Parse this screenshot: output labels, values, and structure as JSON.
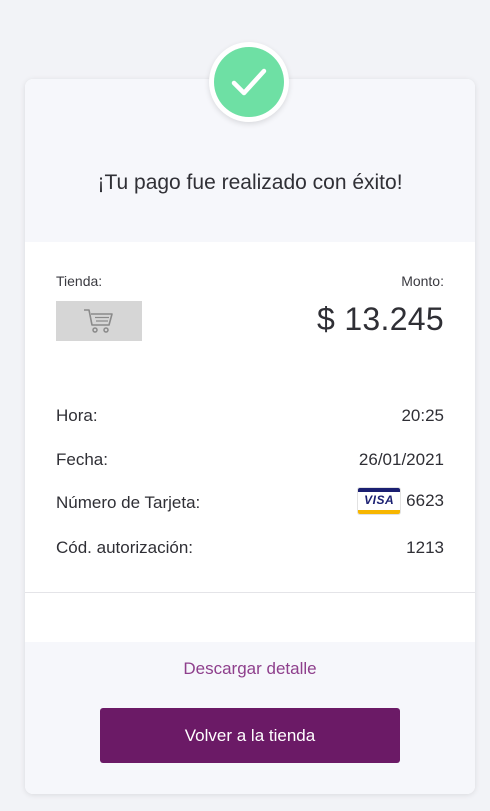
{
  "header": {
    "title": "¡Tu pago fue realizado con éxito!",
    "status_icon": "check-icon",
    "status_color": "#6ee0a4"
  },
  "summary": {
    "store_label": "Tienda:",
    "store_logo_icon": "shopping-cart-icon",
    "amount_label": "Monto:",
    "amount_value": "$ 13.245"
  },
  "details": [
    {
      "label": "Hora:",
      "value": "20:25"
    },
    {
      "label": "Fecha:",
      "value": "26/01/2021"
    },
    {
      "label": "Número de Tarjeta:",
      "value": "6623",
      "card_brand": "VISA"
    },
    {
      "label": "Cód. autorización:",
      "value": "1213"
    }
  ],
  "actions": {
    "download_label": "Descargar detalle",
    "back_label": "Volver a la tienda",
    "accent_color": "#6b1a66",
    "link_color": "#8e3f8c"
  }
}
